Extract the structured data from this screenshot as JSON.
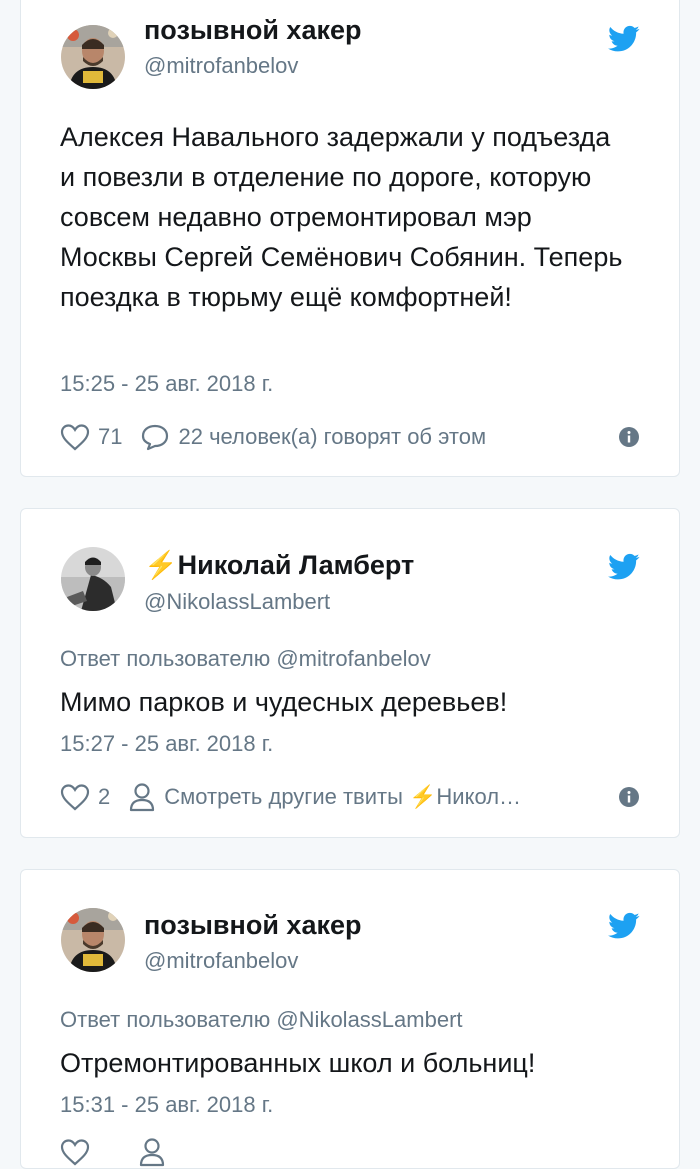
{
  "colors": {
    "background": "#f5f8fa",
    "card": "#ffffff",
    "border": "#e1e8ed",
    "text": "#14171a",
    "muted": "#657786",
    "twitter_blue": "#1da1f2",
    "lightning": "#ffac33"
  },
  "tweets": [
    {
      "name": "позывной хакер",
      "handle": "@mitrofanbelov",
      "text": "Алексея Навального задержали у подъезда и повезли в отделение по дороге, которую совсем недавно отремонтировал мэр Москвы Сергей Семёнович Собянин. Теперь поездка в тюрьму ещё комфортней!",
      "time": "15:25 - 25 авг. 2018 г.",
      "likes": "71",
      "action_label": "22 человек(а) говорят об этом",
      "avatar_icon": "avatar-photo-icon"
    },
    {
      "name_emoji": "⚡",
      "name": "Николай Ламберт",
      "handle": "@NikolassLambert",
      "reply_to": "Ответ пользователю @mitrofanbelov",
      "text": "Мимо парков и чудесных деревьев!",
      "time": "15:27 - 25 авг. 2018 г.",
      "likes": "2",
      "action_label": "Смотреть другие твиты ⚡Никол…",
      "avatar_icon": "avatar-photo-icon"
    },
    {
      "name": "позывной хакер",
      "handle": "@mitrofanbelov",
      "reply_to": "Ответ пользователю @NikolassLambert",
      "text": "Отремонтированных школ и больниц!",
      "time": "15:31 - 25 авг. 2018 г.",
      "avatar_icon": "avatar-photo-icon"
    }
  ]
}
